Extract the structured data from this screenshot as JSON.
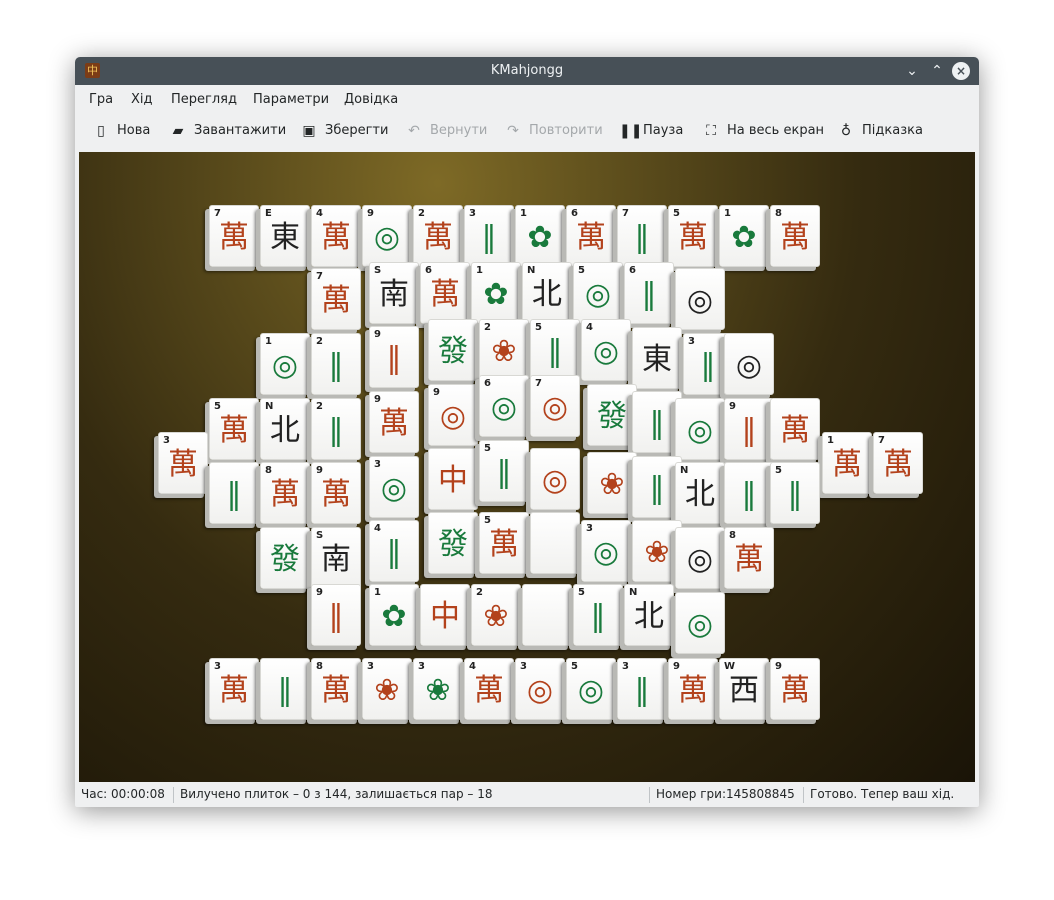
{
  "window": {
    "title": "KMahjongg",
    "controls": [
      "chevron-down",
      "chevron-up",
      "close"
    ]
  },
  "menu": [
    "Гра",
    "Хід",
    "Перегляд",
    "Параметри",
    "Довідка"
  ],
  "toolbar": {
    "new": "Нова",
    "load": "Завантажити",
    "save": "Зберегти",
    "undo": "Вернути",
    "redo": "Повторити",
    "pause": "Пауза",
    "fullscreen": "На весь екран",
    "hint": "Підказка"
  },
  "status": {
    "time": "Час: 00:00:08",
    "tiles": "Вилучено плиток – 0 з 144, залишається пар – 18",
    "game": "Номер гри:145808845",
    "message": "Готово. Тепер ваш хід."
  },
  "tiles": [
    {
      "n": "7",
      "g": "萬",
      "c": "red"
    },
    {
      "n": "E",
      "g": "東",
      "c": "black"
    },
    {
      "n": "4",
      "g": "萬",
      "c": "red"
    },
    {
      "n": "9",
      "g": "◎",
      "c": "green"
    },
    {
      "n": "2",
      "g": "萬",
      "c": "red"
    },
    {
      "n": "3",
      "g": "‖",
      "c": "green"
    },
    {
      "n": "1",
      "g": "✿",
      "c": "green"
    },
    {
      "n": "6",
      "g": "萬",
      "c": "red"
    },
    {
      "n": "7",
      "g": "‖",
      "c": "green"
    },
    {
      "n": "5",
      "g": "萬",
      "c": "red"
    },
    {
      "n": "1",
      "g": "✿",
      "c": "green"
    },
    {
      "n": "8",
      "g": "萬",
      "c": "red"
    },
    {
      "n": "7",
      "g": "萬",
      "c": "red"
    },
    {
      "n": "S",
      "g": "南",
      "c": "black"
    },
    {
      "n": "6",
      "g": "萬",
      "c": "red"
    },
    {
      "n": "1",
      "g": "✿",
      "c": "green"
    },
    {
      "n": "N",
      "g": "北",
      "c": "black"
    },
    {
      "n": "5",
      "g": "◎",
      "c": "green"
    },
    {
      "n": "6",
      "g": "‖",
      "c": "green"
    },
    {
      "n": "",
      "g": "◎",
      "c": "black"
    },
    {
      "n": "9",
      "g": "‖",
      "c": "red"
    },
    {
      "n": "",
      "g": "發",
      "c": "green"
    },
    {
      "n": "2",
      "g": "❀",
      "c": "red"
    },
    {
      "n": "5",
      "g": "‖",
      "c": "green"
    },
    {
      "n": "4",
      "g": "◎",
      "c": "green"
    },
    {
      "n": "",
      "g": "東",
      "c": "black"
    },
    {
      "n": "1",
      "g": "◎",
      "c": "green"
    },
    {
      "n": "2",
      "g": "‖",
      "c": "green"
    },
    {
      "n": "3",
      "g": "‖",
      "c": "green"
    },
    {
      "n": "",
      "g": "◎",
      "c": "black"
    },
    {
      "n": "5",
      "g": "萬",
      "c": "red"
    },
    {
      "n": "N",
      "g": "北",
      "c": "black"
    },
    {
      "n": "2",
      "g": "‖",
      "c": "green"
    },
    {
      "n": "9",
      "g": "萬",
      "c": "red"
    },
    {
      "n": "9",
      "g": "◎",
      "c": "red"
    },
    {
      "n": "6",
      "g": "◎",
      "c": "green"
    },
    {
      "n": "7",
      "g": "◎",
      "c": "red"
    },
    {
      "n": "",
      "g": "發",
      "c": "green"
    },
    {
      "n": "",
      "g": "‖",
      "c": "green"
    },
    {
      "n": "",
      "g": "◎",
      "c": "green"
    },
    {
      "n": "9",
      "g": "‖",
      "c": "red"
    },
    {
      "n": "",
      "g": "萬",
      "c": "red"
    },
    {
      "n": "1",
      "g": "萬",
      "c": "red"
    },
    {
      "n": "7",
      "g": "萬",
      "c": "red"
    },
    {
      "n": "3",
      "g": "萬",
      "c": "red"
    },
    {
      "n": "",
      "g": "‖",
      "c": "green"
    },
    {
      "n": "8",
      "g": "萬",
      "c": "red"
    },
    {
      "n": "9",
      "g": "萬",
      "c": "red"
    },
    {
      "n": "3",
      "g": "◎",
      "c": "green"
    },
    {
      "n": "",
      "g": "中",
      "c": "red"
    },
    {
      "n": "5",
      "g": "‖",
      "c": "green"
    },
    {
      "n": "",
      "g": "◎",
      "c": "red"
    },
    {
      "n": "",
      "g": "❀",
      "c": "red"
    },
    {
      "n": "",
      "g": "‖",
      "c": "green"
    },
    {
      "n": "N",
      "g": "北",
      "c": "black"
    },
    {
      "n": "",
      "g": "‖",
      "c": "green"
    },
    {
      "n": "5",
      "g": "‖",
      "c": "green"
    },
    {
      "n": "",
      "g": "發",
      "c": "green"
    },
    {
      "n": "S",
      "g": "南",
      "c": "black"
    },
    {
      "n": "4",
      "g": "‖",
      "c": "green"
    },
    {
      "n": "",
      "g": "發",
      "c": "green"
    },
    {
      "n": "5",
      "g": "萬",
      "c": "red"
    },
    {
      "n": "",
      "g": "",
      "c": "black"
    },
    {
      "n": "3",
      "g": "◎",
      "c": "green"
    },
    {
      "n": "",
      "g": "❀",
      "c": "red"
    },
    {
      "n": "",
      "g": "◎",
      "c": "black"
    },
    {
      "n": "8",
      "g": "萬",
      "c": "red"
    },
    {
      "n": "9",
      "g": "‖",
      "c": "red"
    },
    {
      "n": "1",
      "g": "✿",
      "c": "green"
    },
    {
      "n": "",
      "g": "中",
      "c": "red"
    },
    {
      "n": "2",
      "g": "❀",
      "c": "red"
    },
    {
      "n": "",
      "g": "",
      "c": "black"
    },
    {
      "n": "5",
      "g": "‖",
      "c": "green"
    },
    {
      "n": "N",
      "g": "北",
      "c": "black"
    },
    {
      "n": "",
      "g": "◎",
      "c": "green"
    },
    {
      "n": "3",
      "g": "萬",
      "c": "red"
    },
    {
      "n": "",
      "g": "‖",
      "c": "green"
    },
    {
      "n": "8",
      "g": "萬",
      "c": "red"
    },
    {
      "n": "3",
      "g": "❀",
      "c": "red"
    },
    {
      "n": "3",
      "g": "❀",
      "c": "green"
    },
    {
      "n": "4",
      "g": "萬",
      "c": "red"
    },
    {
      "n": "3",
      "g": "◎",
      "c": "red"
    },
    {
      "n": "5",
      "g": "◎",
      "c": "green"
    },
    {
      "n": "3",
      "g": "‖",
      "c": "green"
    },
    {
      "n": "9",
      "g": "萬",
      "c": "red"
    },
    {
      "n": "W",
      "g": "西",
      "c": "black"
    },
    {
      "n": "9",
      "g": "萬",
      "c": "red"
    }
  ]
}
